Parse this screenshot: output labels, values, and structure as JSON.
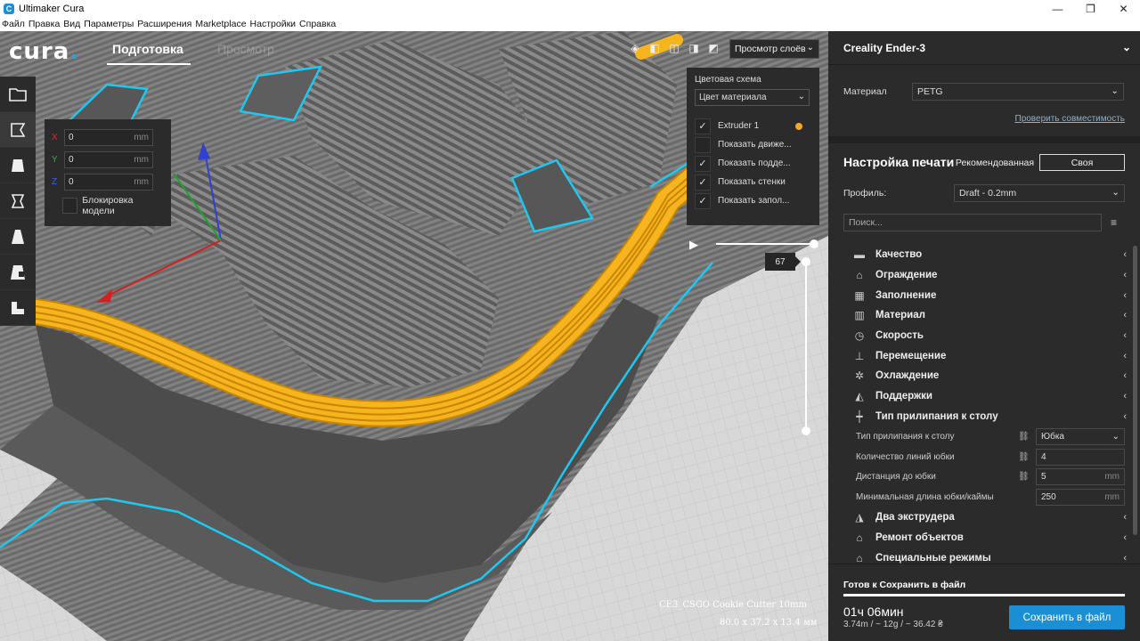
{
  "window": {
    "title": "Ultimaker Cura",
    "app_icon": "C",
    "minimize": "—",
    "maximize": "❐",
    "close": "✕"
  },
  "menu": [
    "Файл",
    "Правка",
    "Вид",
    "Параметры",
    "Расширения",
    "Marketplace",
    "Настройки",
    "Справка"
  ],
  "header": {
    "logo": "cura",
    "tab_prepare": "Подготовка",
    "tab_preview": "Просмотр",
    "view_select": "Просмотр слоёв"
  },
  "move_panel": {
    "x_label": "X",
    "x_value": "0",
    "y_label": "Y",
    "y_value": "0",
    "z_label": "Z",
    "z_value": "0",
    "unit": "mm",
    "lock_label": "Блокировка модели"
  },
  "layer_panel": {
    "scheme_label": "Цветовая схема",
    "scheme_value": "Цвет материала",
    "options": [
      {
        "label": "Extruder 1",
        "checked": true
      },
      {
        "label": "Показать движе...",
        "checked": false
      },
      {
        "label": "Показать подде...",
        "checked": true
      },
      {
        "label": "Показать стенки",
        "checked": true
      },
      {
        "label": "Показать запол...",
        "checked": true
      }
    ],
    "extruder_color": "#f6a623"
  },
  "layer_slider": {
    "current_layer": "67"
  },
  "model": {
    "name": "CE3_CSGO Cookie Cutter 10mm",
    "dimensions": "80.0 x 37.2 x 13.4 мм"
  },
  "right_panel": {
    "printer": "Creality Ender-3",
    "material_label": "Материал",
    "material_value": "PETG",
    "compat_link": "Проверить совместимость",
    "print_setup": "Настройка печати",
    "mode_recommended": "Рекомендованная",
    "mode_custom": "Своя",
    "profile_label": "Профиль:",
    "profile_value": "Draft - 0.2mm",
    "search_placeholder": "Поиск...",
    "categories_top": [
      {
        "icon": "quality-icon",
        "label": "Качество"
      },
      {
        "icon": "shell-icon",
        "label": "Ограждение"
      },
      {
        "icon": "infill-icon",
        "label": "Заполнение"
      },
      {
        "icon": "material-icon",
        "label": "Материал"
      },
      {
        "icon": "speed-icon",
        "label": "Скорость"
      },
      {
        "icon": "travel-icon",
        "label": "Перемещение"
      },
      {
        "icon": "cooling-icon",
        "label": "Охлаждение"
      },
      {
        "icon": "support-icon",
        "label": "Поддержки"
      },
      {
        "icon": "adhesion-icon",
        "label": "Тип прилипания к столу"
      }
    ],
    "adhesion_settings": [
      {
        "label": "Тип прилипания к столу",
        "value": "Юбка",
        "type": "select",
        "linked": true
      },
      {
        "label": "Количество линий юбки",
        "value": "4",
        "type": "input",
        "linked": true
      },
      {
        "label": "Дистанция до юбки",
        "value": "5",
        "unit": "mm",
        "type": "input",
        "linked": true
      },
      {
        "label": "Минимальная длина юбки/каймы",
        "value": "250",
        "unit": "mm",
        "type": "input",
        "linked": false
      }
    ],
    "categories_bottom": [
      {
        "icon": "dual-extruder-icon",
        "label": "Два экструдера"
      },
      {
        "icon": "mesh-fix-icon",
        "label": "Ремонт объектов"
      },
      {
        "icon": "special-modes-icon",
        "label": "Специальные режимы"
      }
    ]
  },
  "bottom": {
    "ready_text": "Готов к Сохранить в файл",
    "progress": 1.0,
    "print_time": "01ч 06мин",
    "stats": "3.74m / ~ 12g / ~ 36.42 ₴",
    "save_button": "Сохранить в файл"
  },
  "colors": {
    "accent": "#1a8fd6",
    "panel": "#2b2b2b",
    "extruder": "#f6a623",
    "outline": "#1ec8f0"
  }
}
